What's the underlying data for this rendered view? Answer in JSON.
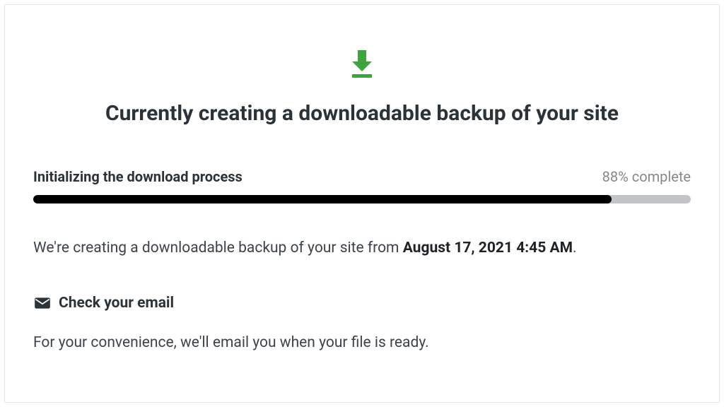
{
  "title": "Currently creating a downloadable backup of your site",
  "progress": {
    "label": "Initializing the download process",
    "percent_text": "88% complete",
    "percent": 88
  },
  "description": {
    "prefix": "We're creating a downloadable backup of your site from ",
    "timestamp": "August 17, 2021 4:45 AM",
    "suffix": "."
  },
  "email": {
    "heading": "Check your email",
    "note": "For your convenience, we'll email you when your file is ready."
  }
}
